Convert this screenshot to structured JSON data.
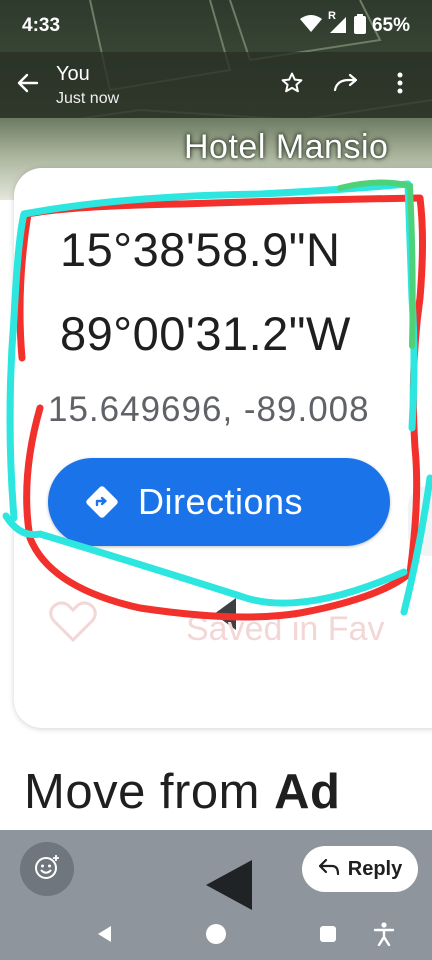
{
  "status_bar": {
    "time": "4:33",
    "battery_percent": "65%",
    "signal_letter": "R"
  },
  "header": {
    "sender": "You",
    "timestamp": "Just now",
    "icons": [
      "back-arrow-icon",
      "star-icon",
      "forward-icon",
      "more-vert-icon"
    ]
  },
  "image": {
    "place_name": "Hotel Mansio",
    "coordinates": {
      "latitude_dms": "15°38'58.9\"N",
      "longitude_dms": "89°00'31.2\"W",
      "decimal": "15.649696, -89.008"
    },
    "directions_label": "Directions",
    "saved_label": "Saved in Fav",
    "caption_regular": "Move from ",
    "caption_bold": "Ad",
    "annotation_colors": {
      "cyan": "#2ee6e0",
      "red": "#f2312c",
      "green": "#4dd27a"
    }
  },
  "reply_bar": {
    "reply_label": "Reply"
  },
  "colors": {
    "primary_blue": "#1a73e8",
    "bar_gray": "#8e959c"
  }
}
